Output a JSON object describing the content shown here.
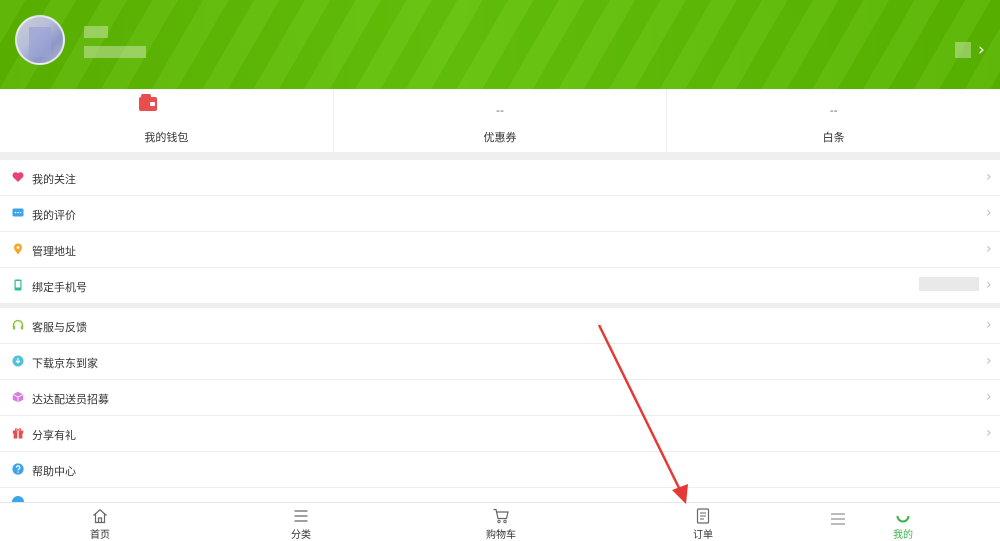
{
  "stats": [
    {
      "value": "",
      "label": "我的钱包"
    },
    {
      "value": "--",
      "label": "优惠券"
    },
    {
      "value": "--",
      "label": "白条"
    }
  ],
  "header": {
    "chevron": "›"
  },
  "menu_group_1": [
    {
      "label": "我的关注",
      "icon": "heart-icon"
    },
    {
      "label": "我的评价",
      "icon": "comment-icon"
    },
    {
      "label": "管理地址",
      "icon": "location-pin-icon"
    },
    {
      "label": "绑定手机号",
      "icon": "phone-icon"
    }
  ],
  "menu_group_2": [
    {
      "label": "客服与反馈",
      "icon": "headset-icon"
    },
    {
      "label": "下载京东到家",
      "icon": "download-icon"
    },
    {
      "label": "达达配送员招募",
      "icon": "box-icon"
    },
    {
      "label": "分享有礼",
      "icon": "gift-icon"
    },
    {
      "label": "帮助中心",
      "icon": "help-icon"
    }
  ],
  "chevron": "›",
  "tabs": [
    {
      "label": "首页",
      "icon": "home-icon"
    },
    {
      "label": "分类",
      "icon": "list-icon"
    },
    {
      "label": "购物车",
      "icon": "cart-icon"
    },
    {
      "label": "订单",
      "icon": "order-icon"
    },
    {
      "label": "我的",
      "icon": "profile-icon",
      "active": true
    }
  ],
  "colors": {
    "header_green": "#5bb300",
    "active_tab": "#3bb34a",
    "annotation_arrow": "#e53935"
  }
}
